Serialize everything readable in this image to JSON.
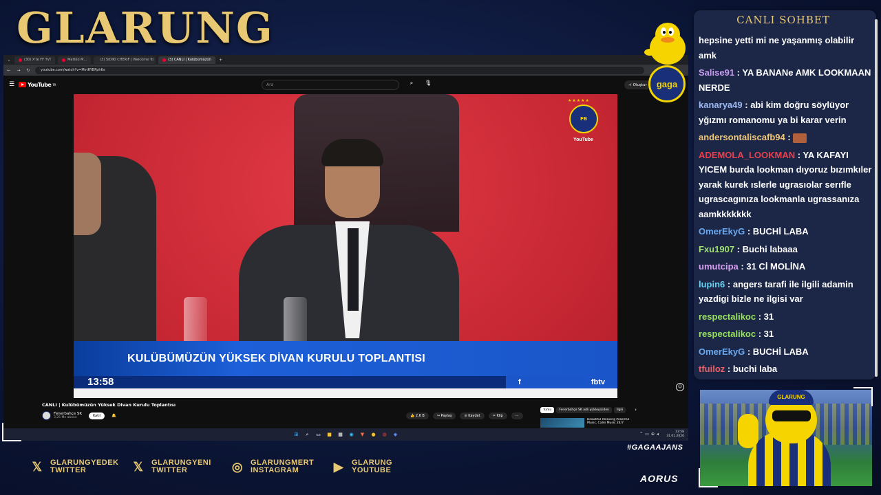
{
  "brand": {
    "title": "GLARUNG"
  },
  "browser": {
    "tabs": [
      {
        "label": "(30) X'te FF TV!"
      },
      {
        "label": "Mattéo M..."
      },
      {
        "label": "(3) SIDIKI CHERIF | Welcome To"
      },
      {
        "label": "(3) CANLI | Kulübümüzün"
      }
    ],
    "url": "youtube.com/watch?v=MvtRYBPphKs"
  },
  "youtube": {
    "logo_text": "YouTube",
    "logo_sup": "TR",
    "search_placeholder": "Ara",
    "create_label": "Oluştur",
    "video": {
      "lower_title": "KULÜBÜMÜZÜN YÜKSEK DİVAN KURULU TOPLANTISI",
      "time": "13:58",
      "fbtv": "fbtv",
      "corner_brand": "YouTube"
    },
    "title": "CANLI | Kulübümüzün Yüksek Divan Kurulu Toplantısı",
    "channel": "Fenerbahçe SK",
    "subscribers": "3,25 Mn abone",
    "join_label": "Katıl",
    "actions": [
      {
        "label": "2,6 B"
      },
      {
        "label": "Paylaş"
      },
      {
        "label": "Kaydet"
      },
      {
        "label": "Klip"
      }
    ],
    "chips": [
      {
        "label": "Tümü"
      },
      {
        "label": "Fenerbahçe SK adlı yükleyiciden"
      },
      {
        "label": "İlgili"
      }
    ],
    "recommended": {
      "title": "Beautiful Relaxing Peaceful Music, Calm Music 24/7"
    }
  },
  "taskbar": {
    "time": "13:58",
    "date": "31.01.2026"
  },
  "chat": {
    "title": "CANLI SOHBET",
    "messages": [
      {
        "user": "",
        "text": "hepsine yetti mi ne yaşanmış olabilir amk",
        "color": "#ffffff"
      },
      {
        "user": "Salise91",
        "text": "YA BANANe AMK LOOKMAAN NERDE",
        "color": "#c89cf0"
      },
      {
        "user": "kanarya49",
        "text": "abi kim doğru söylüyor yğızmı romanomu ya bi karar verin",
        "color": "#9cb8f0"
      },
      {
        "user": "andersontaliscafb94",
        "text": "",
        "color": "#f0c878"
      },
      {
        "user": "ADEMOLA_LOOKMAN",
        "text": "YA KAFAYI YICEM burda lookman dıyoruz bızımkıler yarak kurek ıslerle ugrasıolar serıfle ugrascagınıza lookmanla ugrassanıza aamkkkkkkk",
        "color": "#e8404c"
      },
      {
        "user": "OmerEkyG",
        "text": "BUCHİ LABA",
        "color": "#6aa8f0"
      },
      {
        "user": "Fxu1907",
        "text": "Buchi labaaa",
        "color": "#a0e070"
      },
      {
        "user": "umutcipa",
        "text": "31 Cİ MOLİNA",
        "color": "#d8a0f0"
      },
      {
        "user": "lupin6",
        "text": "angers tarafi ile ilgili adamin yazdigi bizle ne ilgisi var",
        "color": "#6ad0f0"
      },
      {
        "user": "respectalikoc",
        "text": "31",
        "color": "#98e060"
      },
      {
        "user": "respectalikoc",
        "text": "31",
        "color": "#98e060"
      },
      {
        "user": "OmerEkyG",
        "text": "BUCHİ LABA",
        "color": "#6aa8f0"
      },
      {
        "user": "tfuiloz",
        "text": "buchi laba",
        "color": "#f06060"
      }
    ]
  },
  "gaga_badge": "gaga",
  "cam": {
    "hat_text": "GLARUNG"
  },
  "footer": {
    "socials": [
      {
        "line1": "GLARUNGYEDEK",
        "line2": "TWITTER",
        "icon": "x-icon"
      },
      {
        "line1": "GLARUNGYENI",
        "line2": "TWITTER",
        "icon": "x-icon"
      },
      {
        "line1": "GLARUNGMERT",
        "line2": "INSTAGRAM",
        "icon": "instagram-icon"
      },
      {
        "line1": "GLARUNG",
        "line2": "YOUTUBE",
        "icon": "youtube-icon"
      }
    ],
    "hashtag": "#GAGAAJANS",
    "sponsor": "AORUS"
  }
}
